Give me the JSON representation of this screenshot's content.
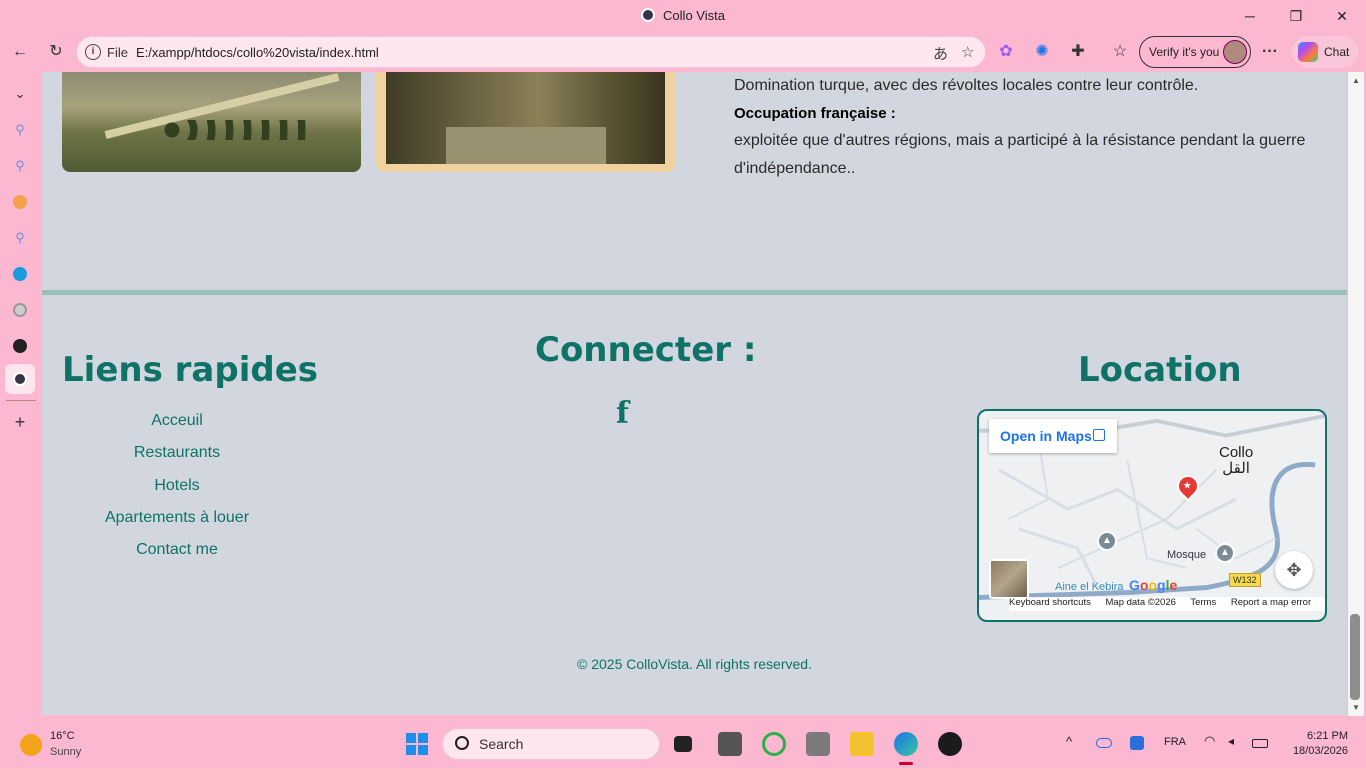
{
  "window": {
    "title": "Collo Vista",
    "minimize": "─",
    "maximize": "❐",
    "close": "✕"
  },
  "toolbar": {
    "back": "←",
    "refresh": "↻",
    "scheme_label": "File",
    "url": "E:/xampp/htdocs/collo%20vista/index.html",
    "verify_label": "Verify it's you",
    "chat_label": "Chat",
    "more": "···"
  },
  "history": {
    "line1": "Domination turque, avec des révoltes locales contre leur contrôle.",
    "heading": "Occupation française :",
    "paragraph": "exploitée que d'autres régions, mais a participé à la résistance pendant la guerre d'indépendance.."
  },
  "footer": {
    "links_title": "Liens rapides",
    "links": [
      "Acceuil",
      "Restaurants",
      "Hotels",
      "Apartements à louer",
      "Contact me"
    ],
    "connect_title": "Connecter :",
    "facebook_glyph": "f",
    "location_title": "Location",
    "copyright": "© 2025 ColloVista. All rights reserved."
  },
  "map": {
    "open_maps": "Open in Maps",
    "city_latin": "Collo",
    "city_arabic": "القل",
    "mosque_label": "Mosque",
    "place_label": "Aine el Kebira",
    "road_tag": "W132",
    "google": "Google",
    "footer_items": [
      "Keyboard shortcuts",
      "Map data ©2026",
      "Terms",
      "Report a map error"
    ]
  },
  "taskbar": {
    "temperature": "16°C",
    "weather": "Sunny",
    "search_placeholder": "Search",
    "language": "FRA",
    "time": "6:21 PM",
    "date": "18/03/2026",
    "chevron": "^"
  },
  "colors": {
    "accent": "#0e7366",
    "page_bg": "#d2d6df",
    "browser_chrome": "#fcb8d0"
  }
}
